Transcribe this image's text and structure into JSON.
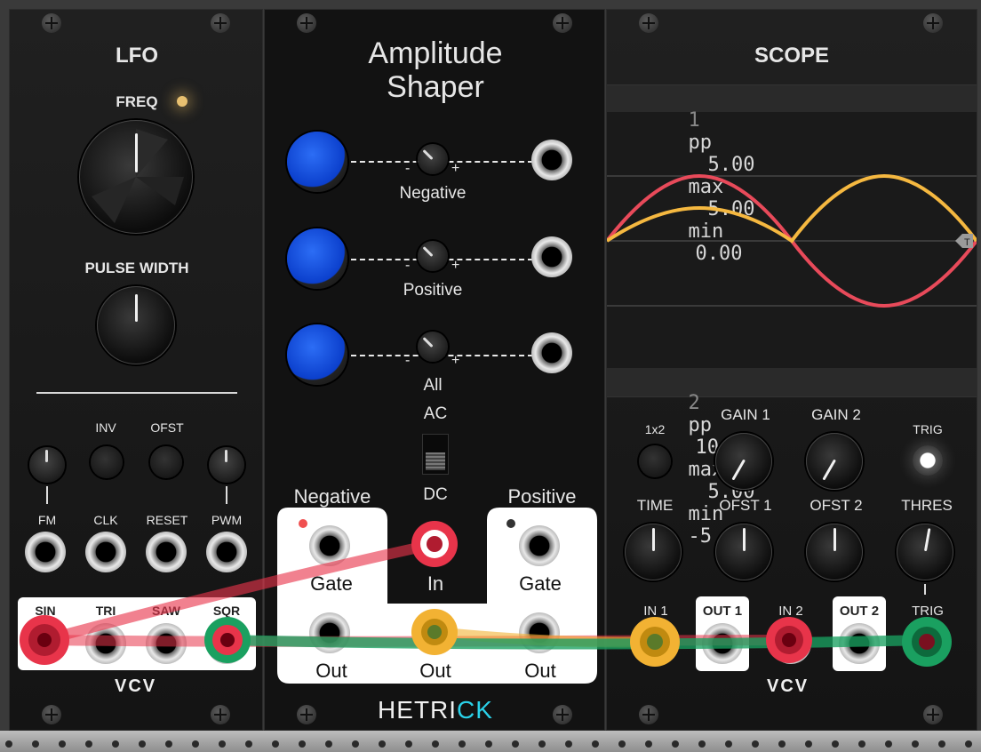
{
  "lfo": {
    "title": "LFO",
    "freq_label": "FREQ",
    "pulse_width_label": "PULSE WIDTH",
    "inv_label": "INV",
    "ofst_label": "OFST",
    "fm_label": "FM",
    "clk_label": "CLK",
    "reset_label": "RESET",
    "pwm_label": "PWM",
    "outputs": [
      "SIN",
      "TRI",
      "SAW",
      "SQR"
    ],
    "logo": "VCV"
  },
  "shaper": {
    "title_line1": "Amplitude",
    "title_line2": "Shaper",
    "row_labels": [
      "Negative",
      "Positive",
      "All"
    ],
    "minus": "-",
    "plus": "+",
    "ac_label": "AC",
    "dc_label": "DC",
    "negative_heading": "Negative",
    "positive_heading": "Positive",
    "gate_label": "Gate",
    "in_label": "In",
    "out_label": "Out",
    "brand_a": "HETRI",
    "brand_b": "CK"
  },
  "scope": {
    "title": "SCOPE",
    "ch1": {
      "index": "1",
      "pp_label": "pp",
      "pp": "5.00",
      "max_label": "max",
      "max": "5.00",
      "min_label": "min",
      "min": "0.00"
    },
    "ch2": {
      "index": "2",
      "pp_label": "pp",
      "pp": "10.00",
      "max_label": "max",
      "max": "5.00",
      "min_label": "min",
      "min": "-5.00"
    },
    "trigger_marker": "T",
    "x2_label": "1x2",
    "gain1_label": "GAIN 1",
    "gain2_label": "GAIN 2",
    "trig_label": "TRIG",
    "time_label": "TIME",
    "ofst1_label": "OFST 1",
    "ofst2_label": "OFST 2",
    "thres_label": "THRES",
    "in1_label": "IN 1",
    "out1_label": "OUT 1",
    "in2_label": "IN 2",
    "out2_label": "OUT 2",
    "trig_in_label": "TRIG",
    "logo": "VCV"
  },
  "colors": {
    "cable_red": "#e8344a",
    "cable_green": "#1aa060",
    "cable_yellow": "#f2b233",
    "trace1": "#f5b840",
    "trace2": "#e84a5a",
    "knob_blue": "#1f5ae8",
    "brand_cyan": "#2ad0e8"
  }
}
